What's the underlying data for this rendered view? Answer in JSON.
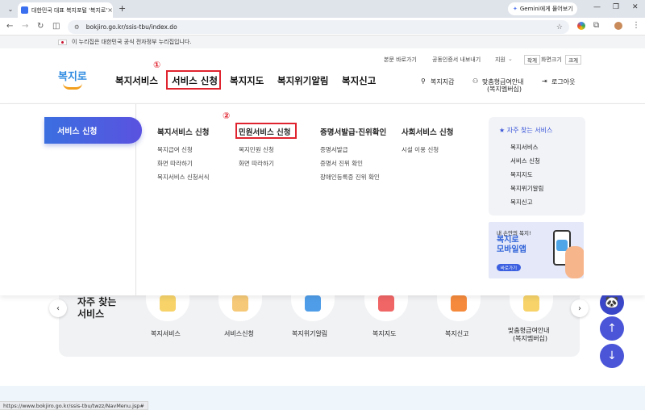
{
  "browser": {
    "tab_title": "대한민국 대표 복지포털 '복지로'",
    "tab_close": "×",
    "new_tab": "+",
    "gemini": "Gemini에게 물어보기",
    "url": "bokjiro.go.kr/ssis-tbu/index.do",
    "status_url": "https://www.bokjiro.go.kr/ssis-tbu/twzz/NavMenu.jsp#"
  },
  "gov_banner": "이 누리집은 대한민국 공식 전자정부 누리집입니다.",
  "utility": {
    "skip_body": "본문 바로가기",
    "cert_export": "공동인증서 내보내기",
    "language": "지원",
    "font_small": "작게",
    "font_label": "화면크기",
    "font_large": "크게"
  },
  "logo": "복지로",
  "gnb": [
    "복지서비스",
    "서비스 신청",
    "복지지도",
    "복지위기알림",
    "복지신고"
  ],
  "annotations": {
    "step1": "①",
    "step2": "②"
  },
  "right_menu": {
    "mypage": "복지지갑",
    "custom": "맞춤형급여안내",
    "custom_sub": "(복지멤버십)",
    "logout": "로그아웃"
  },
  "mega": {
    "side_title": "서비스 신청",
    "columns": [
      {
        "head": "복지서비스 신청",
        "items": [
          "복지급여 신청",
          "화면 따라하기",
          "복지서비스 신청서식"
        ]
      },
      {
        "head": "민원서비스 신청",
        "items": [
          "복지민원 신청",
          "화면 따라하기"
        ]
      },
      {
        "head": "증명서발급·진위확인",
        "items": [
          "증명서발급",
          "증명서 진위 확인",
          "장애인등록증 진위 확인"
        ]
      },
      {
        "head": "사회서비스 신청",
        "items": [
          "시설 이용 신청"
        ]
      }
    ],
    "favorites": {
      "title": "자주 찾는 서비스",
      "items": [
        "복지서비스",
        "서비스 신청",
        "복지지도",
        "복지위기알림",
        "복지신고"
      ]
    },
    "banner": {
      "line1": "내 손안의 복지!",
      "line2": "복지로",
      "line3": "모바일앱",
      "button": "바로가기"
    }
  },
  "frequent": {
    "heading_line1": "자주 찾는",
    "heading_line2": "서비스",
    "items": [
      "복지서비스",
      "서비스신청",
      "복지위기알림",
      "복지지도",
      "복지신고",
      "맞춤형급여안내",
      "(복지멤버십)"
    ],
    "prev": "‹",
    "next": "›"
  },
  "float_buttons": {
    "up": "↑",
    "down": "↓"
  },
  "colors": {
    "accent": "#4a55d8",
    "annotation_red": "#e0242f",
    "logo_blue": "#2f8be0"
  }
}
